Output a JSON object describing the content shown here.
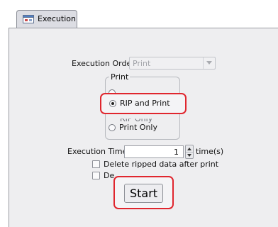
{
  "tab": {
    "label": "Execution",
    "icon": "execution-window-icon"
  },
  "execution_order": {
    "label": "Execution Order",
    "value": "Print"
  },
  "print_group": {
    "title": "Print",
    "options": [
      {
        "label": "RIP and Print",
        "selected": true
      },
      {
        "label": "Print Only",
        "selected": false
      }
    ]
  },
  "execution_times": {
    "label": "Execution Times",
    "value": "1",
    "unit": "time(s)"
  },
  "checkboxes": [
    {
      "label": "Delete ripped data after print",
      "checked": false
    },
    {
      "label": "De",
      "checked": false
    }
  ],
  "start_button": {
    "label": "Start"
  },
  "colors": {
    "highlight": "#e0262e",
    "panel": "#eeeef0",
    "tab": "#dcdde3"
  }
}
